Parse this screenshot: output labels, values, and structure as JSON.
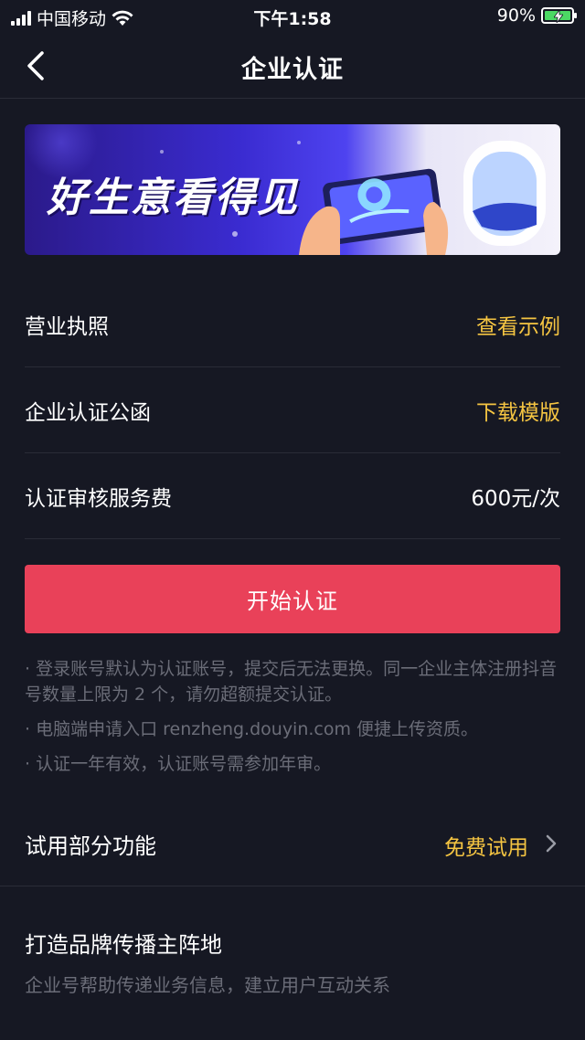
{
  "status_bar": {
    "carrier": "中国移动",
    "time": "下午1:58",
    "battery_percent": "90%",
    "battery_level": 0.9
  },
  "nav": {
    "title": "企业认证",
    "back_icon": "chevron-left-icon"
  },
  "banner": {
    "headline": "好生意看得见"
  },
  "rows": [
    {
      "label": "营业执照",
      "action": "查看示例"
    },
    {
      "label": "企业认证公函",
      "action": "下载模版"
    },
    {
      "label": "认证审核服务费",
      "value": "600元/次"
    }
  ],
  "start_button": {
    "label": "开始认证"
  },
  "notes": [
    "· 登录账号默认为认证账号，提交后无法更换。同一企业主体注册抖音号数量上限为 2 个，请勿超额提交认证。",
    "· 电脑端申请入口 renzheng.douyin.com 便捷上传资质。",
    "· 认证一年有效，认证账号需参加年审。"
  ],
  "trial": {
    "label": "试用部分功能",
    "action": "免费试用"
  },
  "brand": {
    "title": "打造品牌传播主阵地",
    "subtitle": "企业号帮助传递业务信息，建立用户互动关系"
  },
  "colors": {
    "background": "#161823",
    "accent_link": "#f5c542",
    "primary_button": "#e94159",
    "muted_text": "#6b6d78"
  }
}
